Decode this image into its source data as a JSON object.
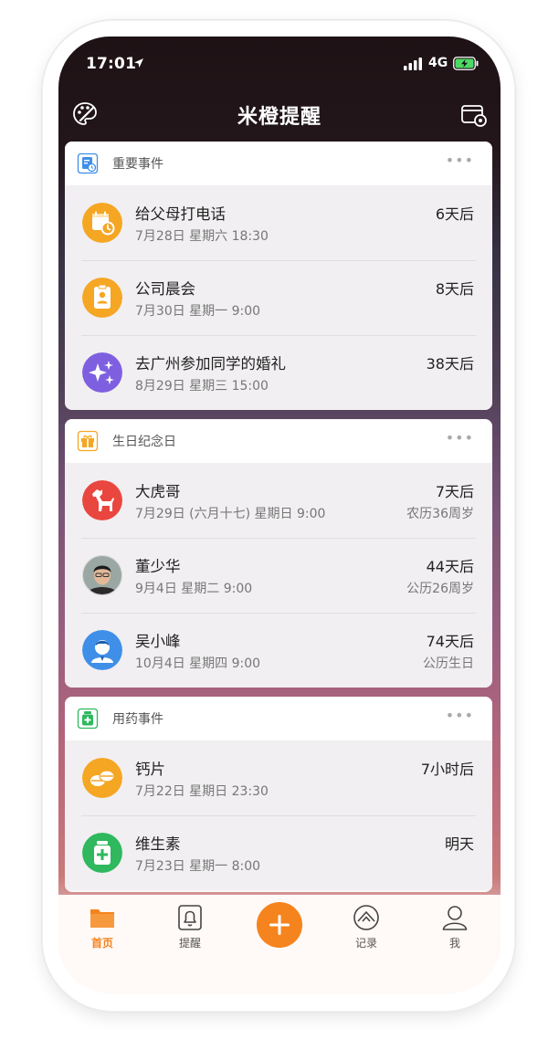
{
  "status_bar": {
    "time": "17:01",
    "network": "4G"
  },
  "header": {
    "title": "米橙提醒"
  },
  "sections": [
    {
      "title": "重要事件",
      "more": "•••",
      "items": [
        {
          "name": "给父母打电话",
          "date": "7月28日  星期六 18:30",
          "countdown": "6天后",
          "extra": ""
        },
        {
          "name": "公司晨会",
          "date": "7月30日  星期一 9:00",
          "countdown": "8天后",
          "extra": ""
        },
        {
          "name": "去广州参加同学的婚礼",
          "date": "8月29日  星期三 15:00",
          "countdown": "38天后",
          "extra": ""
        }
      ]
    },
    {
      "title": "生日纪念日",
      "more": "•••",
      "items": [
        {
          "name": "大虎哥",
          "date": "7月29日 (六月十七) 星期日 9:00",
          "countdown": "7天后",
          "extra": "农历36周岁"
        },
        {
          "name": "董少华",
          "date": "9月4日  星期二 9:00",
          "countdown": "44天后",
          "extra": "公历26周岁"
        },
        {
          "name": "吴小峰",
          "date": "10月4日  星期四 9:00",
          "countdown": "74天后",
          "extra": "公历生日"
        }
      ]
    },
    {
      "title": "用药事件",
      "more": "•••",
      "items": [
        {
          "name": "钙片",
          "date": "7月22日  星期日 23:30",
          "countdown": "7小时后",
          "extra": ""
        },
        {
          "name": "维生素",
          "date": "7月23日  星期一 8:00",
          "countdown": "明天",
          "extra": ""
        }
      ]
    }
  ],
  "tabbar": {
    "home": "首页",
    "remind": "提醒",
    "records": "记录",
    "me": "我"
  },
  "colors": {
    "accent": "#f5841e",
    "blue": "#3f8fe8",
    "purple": "#7e5fe0",
    "red": "#e9463f",
    "green": "#2fb85e"
  },
  "icons": {
    "palette": "palette-icon",
    "settings": "card-settings-icon",
    "calendar": "calendar-clock-icon",
    "badge": "id-badge-icon",
    "stars": "sparkle-stars-icon",
    "dog": "dog-icon",
    "person": "person-icon",
    "pills": "pills-icon",
    "medicine": "medicine-bottle-icon"
  }
}
